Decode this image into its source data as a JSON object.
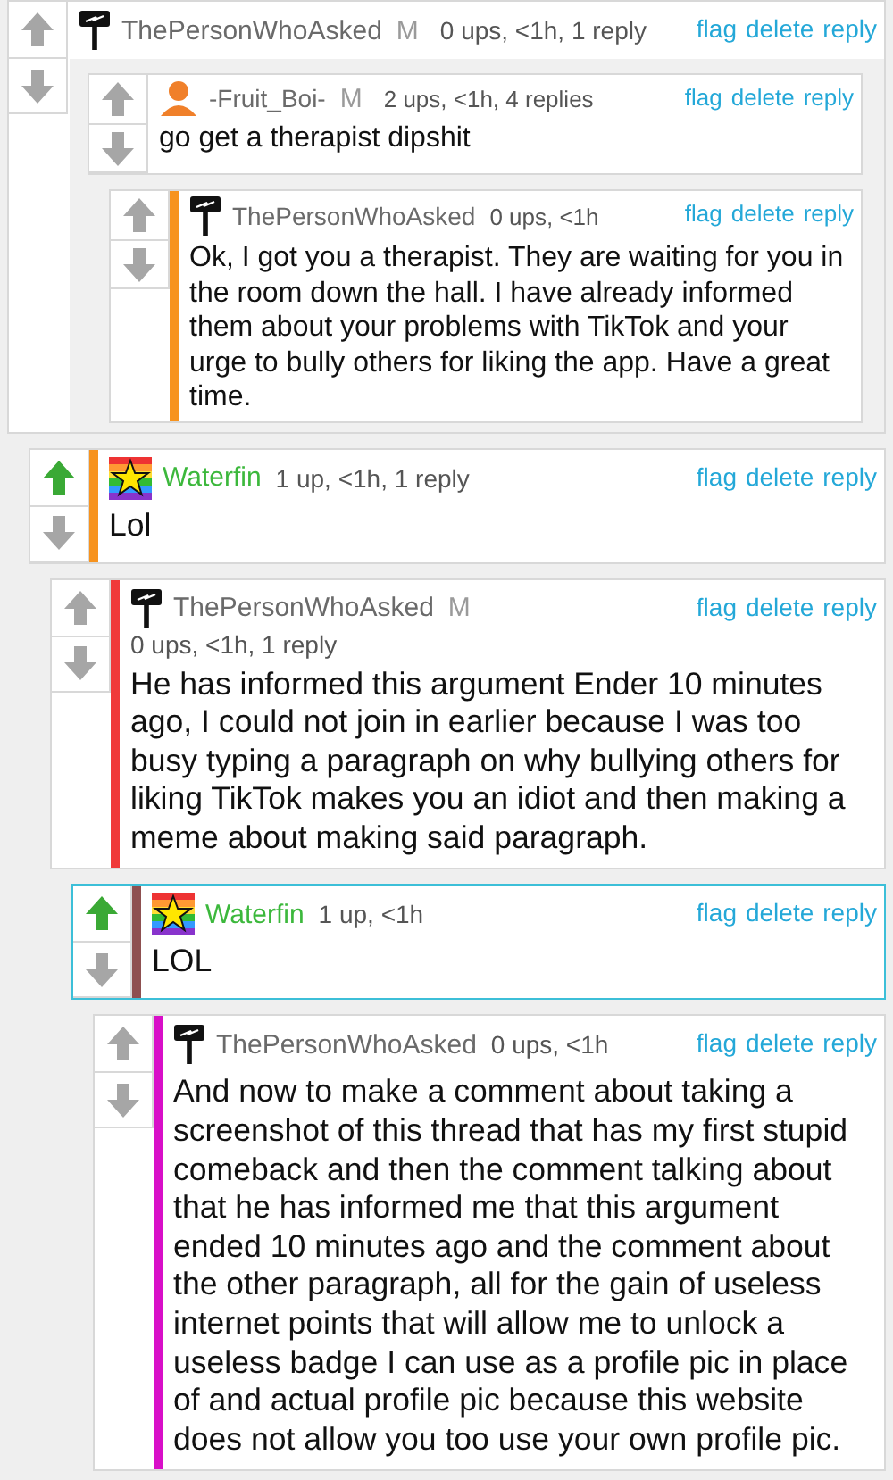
{
  "comments": [
    {
      "author": {
        "avatar": {
          "kind": "signpost"
        },
        "name": "ThePersonWhoAsked",
        "color": "#6a6a6a"
      },
      "badge": "M",
      "meta": "0 ups, <1h, 1 reply",
      "actions": [
        "flag",
        "delete",
        "reply"
      ],
      "upvoted": false,
      "highlighted": false,
      "attachment": {
        "kind": "screenshot",
        "comments": [
          {
            "author": {
              "avatar": {
                "kind": "person"
              },
              "name": "-Fruit_Boi-",
              "color": "#6a6a6a"
            },
            "badge": "M",
            "meta": "2 ups, <1h, 4 replies",
            "actions": [
              "flag",
              "delete",
              "reply"
            ],
            "upvoted": false,
            "highlighted": false,
            "body": "go get a therapist dipshit",
            "children": [
              {
                "author": {
                  "avatar": {
                    "kind": "signpost"
                  },
                  "name": "ThePersonWhoAsked",
                  "color": "#6a6a6a"
                },
                "meta": "0 ups, <1h",
                "actions": [
                  "flag",
                  "delete",
                  "reply"
                ],
                "upvoted": false,
                "highlighted": false,
                "color": "#f7931e",
                "body": "Ok, I got you a therapist. They are waiting for you in the room down the hall. I have already informed them about your problems with TikTok and your urge to bully others for liking the app. Have a great time."
              }
            ]
          }
        ]
      },
      "children": [
        {
          "author": {
            "avatar": {
              "kind": "rainbow-star"
            },
            "name": "Waterfin",
            "color": "#3cb83c"
          },
          "meta": "1 up, <1h, 1 reply",
          "actions": [
            "flag",
            "delete",
            "reply"
          ],
          "upvoted": true,
          "highlighted": false,
          "color": "#f7931e",
          "body": "Lol",
          "children": [
            {
              "author": {
                "avatar": {
                  "kind": "signpost"
                },
                "name": "ThePersonWhoAsked",
                "color": "#6a6a6a"
              },
              "badge": "M",
              "meta": "0 ups, <1h, 1 reply",
              "actions": [
                "flag",
                "delete",
                "reply"
              ],
              "upvoted": false,
              "highlighted": false,
              "color": "#f03a3a",
              "body": "He has informed this argument Ender 10 minutes ago, I could not join in earlier because I was too busy typing a paragraph on why bullying others for liking TikTok makes you an idiot and then making a meme about making said paragraph.",
              "children": [
                {
                  "author": {
                    "avatar": {
                      "kind": "rainbow-star"
                    },
                    "name": "Waterfin",
                    "color": "#3cb83c"
                  },
                  "meta": "1 up, <1h",
                  "actions": [
                    "flag",
                    "delete",
                    "reply"
                  ],
                  "upvoted": true,
                  "highlighted": true,
                  "color": "#8e5050",
                  "body": "LOL",
                  "children": [
                    {
                      "author": {
                        "avatar": {
                          "kind": "signpost"
                        },
                        "name": "ThePersonWhoAsked",
                        "color": "#6a6a6a"
                      },
                      "meta": "0 ups, <1h",
                      "actions": [
                        "flag",
                        "delete",
                        "reply"
                      ],
                      "upvoted": false,
                      "highlighted": false,
                      "color": "#d80fc8",
                      "body": "And now to make a comment about taking a screenshot of this thread that has my first stupid comeback and then the comment talking about that he has informed me that this argument ended 10 minutes ago and the comment about the other paragraph, all for the gain of useless internet points that will allow me to unlock a useless badge I can use as a profile pic in place of and actual profile pic because this website does not allow you too use your own profile pic."
                    }
                  ]
                }
              ]
            }
          ]
        }
      ]
    }
  ]
}
